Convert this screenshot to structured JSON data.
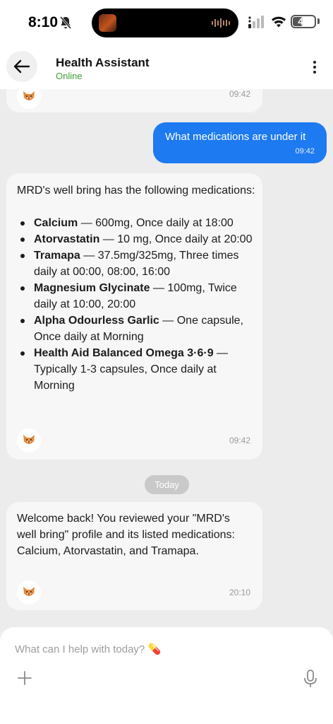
{
  "status_bar": {
    "time": "8:10",
    "battery": "47",
    "battery_level": 0.47
  },
  "header": {
    "title": "Health Assistant",
    "status": "Online"
  },
  "messages": {
    "partial_top": {
      "time": "09:42"
    },
    "user_question": {
      "text": "What medications are under it",
      "time": "09:42"
    },
    "med_reply": {
      "intro": "MRD's well bring has the following medications:",
      "items": [
        {
          "name": "Calcium",
          "detail": " — 600mg, Once daily at 18:00"
        },
        {
          "name": "Atorvastatin",
          "detail": " — 10 mg, Once daily at 20:00"
        },
        {
          "name": "Tramapa",
          "detail": " — 37.5mg/325mg, Three times daily at 00:00, 08:00, 16:00"
        },
        {
          "name": "Magnesium Glycinate",
          "detail": " — 100mg, Twice daily at 10:00, 20:00"
        },
        {
          "name": "Alpha Odourless Garlic",
          "detail": " — One capsule, Once daily at Morning"
        },
        {
          "name": "Health Aid Balanced Omega 3·6·9",
          "detail": " — Typically 1-3 capsules, Once daily at Morning"
        }
      ],
      "time": "09:42"
    },
    "date_divider": "Today",
    "welcome": {
      "text": "Welcome back! You reviewed your \"MRD's well bring\" profile and its listed medications: Calcium, Atorvastatin, and Tramapa.",
      "time": "20:10"
    }
  },
  "composer": {
    "placeholder": "What can I help with today? 💊"
  },
  "colors": {
    "accent": "#1d7af0",
    "online": "#3f9d3a"
  }
}
